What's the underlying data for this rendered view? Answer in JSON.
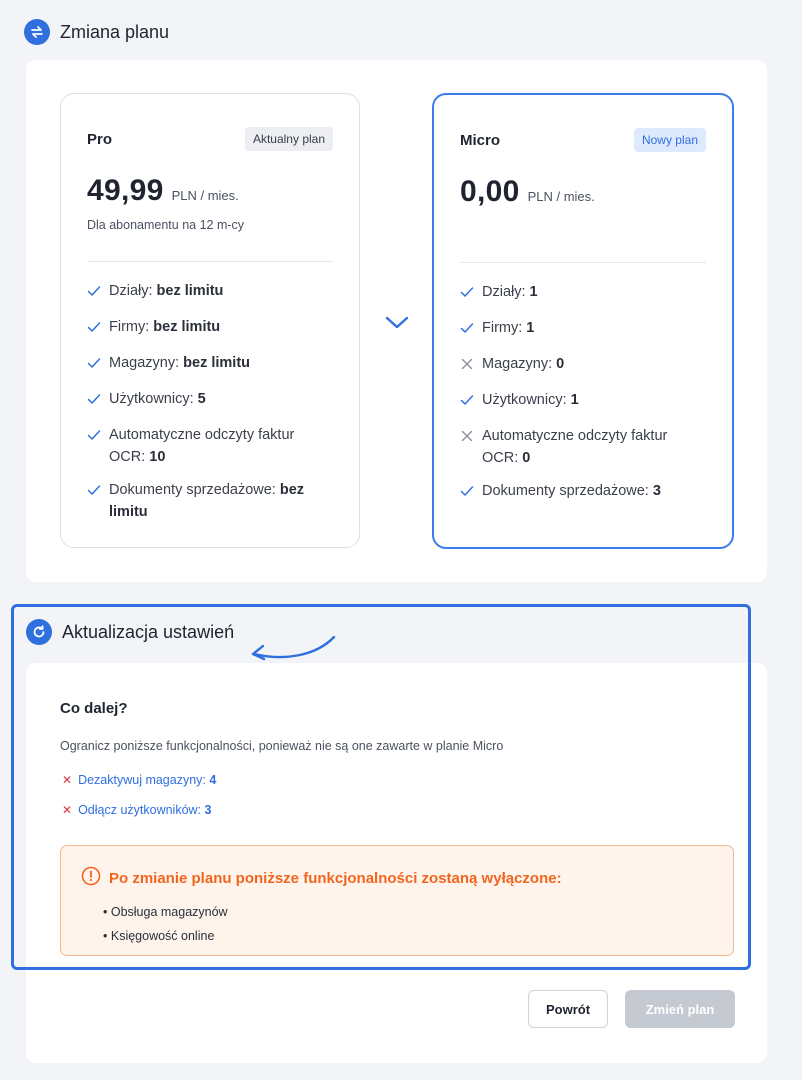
{
  "sections": {
    "change_plan": {
      "title": "Zmiana planu"
    },
    "settings_update": {
      "title": "Aktualizacja ustawień"
    }
  },
  "current_plan": {
    "name": "Pro",
    "badge": "Aktualny plan",
    "price": "49,99",
    "unit": "PLN / mies.",
    "subtext": "Dla abonamentu na 12 m-cy",
    "features": [
      {
        "icon": "check-icon",
        "label": "Działy:",
        "value": "bez limitu"
      },
      {
        "icon": "check-icon",
        "label": "Firmy:",
        "value": "bez limitu"
      },
      {
        "icon": "check-icon",
        "label": "Magazyny:",
        "value": "bez limitu"
      },
      {
        "icon": "check-icon",
        "label": "Użytkownicy:",
        "value": "5"
      },
      {
        "icon": "check-icon",
        "label": "Automatyczne odczyty faktur OCR:",
        "value": "10"
      },
      {
        "icon": "check-icon",
        "label": "Dokumenty sprzedażowe:",
        "value": "bez limitu"
      }
    ]
  },
  "new_plan": {
    "name": "Micro",
    "badge": "Nowy plan",
    "price": "0,00",
    "unit": "PLN / mies.",
    "features": [
      {
        "icon": "check-icon",
        "label": "Działy:",
        "value": "1"
      },
      {
        "icon": "check-icon",
        "label": "Firmy:",
        "value": "1"
      },
      {
        "icon": "cross-icon",
        "label": "Magazyny:",
        "value": "0"
      },
      {
        "icon": "check-icon",
        "label": "Użytkownicy:",
        "value": "1"
      },
      {
        "icon": "cross-icon",
        "label": "Automatyczne odczyty faktur OCR:",
        "value": "0"
      },
      {
        "icon": "check-icon",
        "label": "Dokumenty sprzedażowe:",
        "value": "3"
      }
    ]
  },
  "next_steps": {
    "heading": "Co dalej?",
    "description": "Ogranicz poniższe funkcjonalności, ponieważ nie są one zawarte w planie Micro",
    "actions": [
      {
        "label": "Dezaktywuj magazyny:",
        "count": "4"
      },
      {
        "label": "Odłącz użytkowników:",
        "count": "3"
      }
    ]
  },
  "warning": {
    "title": "Po zmianie planu poniższe funkcjonalności zostaną wyłączone:",
    "items": [
      "Obsługa magazynów",
      "Księgowość online"
    ]
  },
  "buttons": {
    "back": "Powrót",
    "change": "Zmień plan"
  },
  "colors": {
    "accent": "#2f6fe0",
    "highlight_border": "#3b7ded",
    "warning": "#f0661f",
    "warning_bg": "#fff4ec",
    "error": "#e0393e",
    "disabled": "#c5c9d1"
  }
}
